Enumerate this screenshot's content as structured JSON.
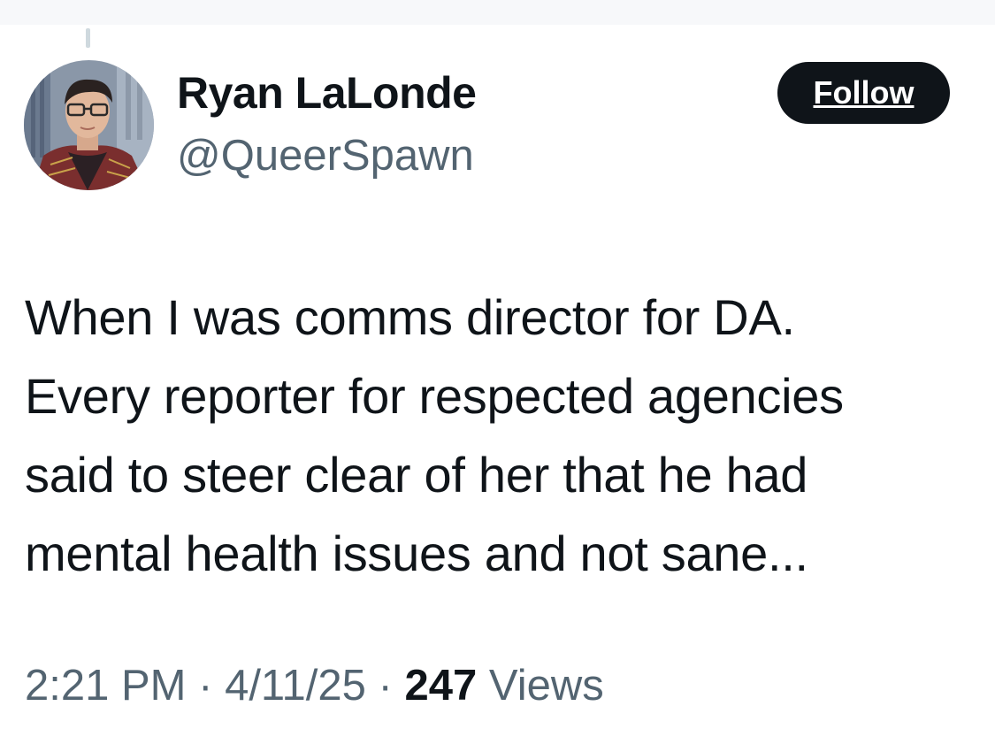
{
  "author": {
    "display_name": "Ryan LaLonde",
    "handle": "@QueerSpawn"
  },
  "follow_button": {
    "label": "Follow"
  },
  "tweet": {
    "text": "When I was comms director for DA.\nEvery reporter for respected agencies\nsaid to steer clear of her that he had\nmental health issues and not sane..."
  },
  "meta": {
    "time": "2:21 PM",
    "separator": "·",
    "date": "4/11/25",
    "views_count": "247",
    "views_label": "Views"
  },
  "colors": {
    "text_primary": "#0f1419",
    "text_secondary": "#536471",
    "follow_bg": "#0f1419",
    "follow_text": "#ffffff"
  },
  "icons": {
    "avatar": "profile-photo"
  }
}
